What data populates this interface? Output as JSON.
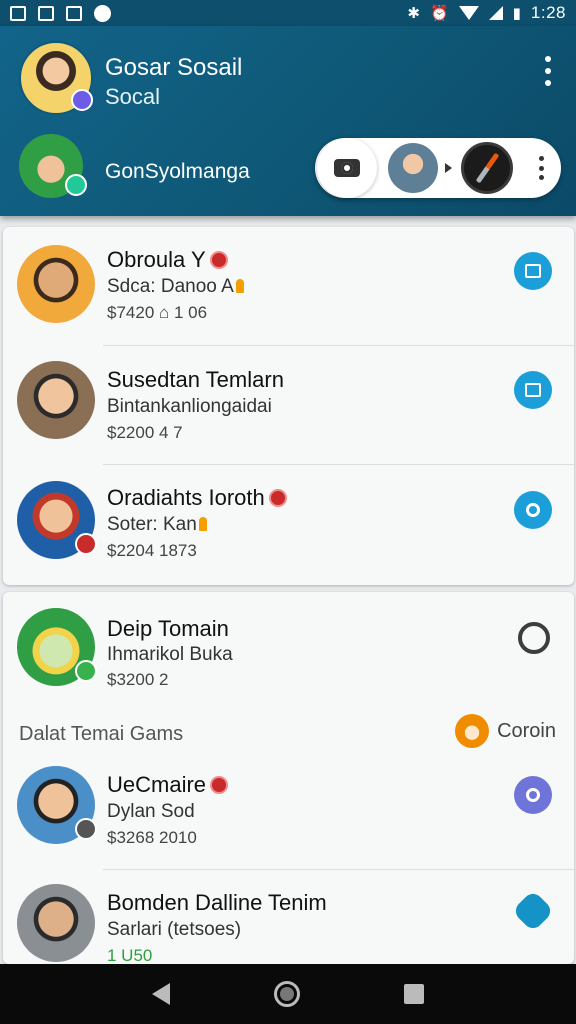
{
  "status_bar": {
    "time": "1:28"
  },
  "header": {
    "title": "Gosar Sosail",
    "subtitle": "Socal",
    "secondary_name": "GonSyolmanga",
    "icons": {
      "camera": "camera-icon",
      "compass": "compass-icon",
      "more": "more-vert-icon"
    }
  },
  "contacts_top": [
    {
      "name": "Obroula Y",
      "sub": "Sdca: Danoo A",
      "meta": "$7420  ⌂ 1 06",
      "action": "edit"
    },
    {
      "name": "Susedtan Temlarn",
      "sub": "Bintankanliongaidai",
      "meta": "$2200  4  7",
      "action": "edit"
    },
    {
      "name": "Oradiahts Ioroth",
      "sub": "Soter: Kan",
      "meta": "$2204  1873",
      "action": "chat"
    }
  ],
  "contacts_bottom": [
    {
      "name": "Deip Tomain",
      "sub": "Ihmarikol Buka",
      "meta": "$3200  2",
      "action": "chat-outline"
    },
    {
      "name": "UeCmaire",
      "sub": "Dylan   Sod",
      "meta": "$3268  2010",
      "action": "chat-purple"
    },
    {
      "name": "Bomden    Dalline Tenim",
      "sub": "Sarlari (tetsoes)",
      "meta": "1 U50",
      "action": "badge"
    }
  ],
  "section": {
    "left": "Dalat Temai Gams",
    "right": "Coroin"
  },
  "colors": {
    "header": "#0f5978",
    "accent": "#1c9ed8",
    "purple": "#6f74d8"
  }
}
